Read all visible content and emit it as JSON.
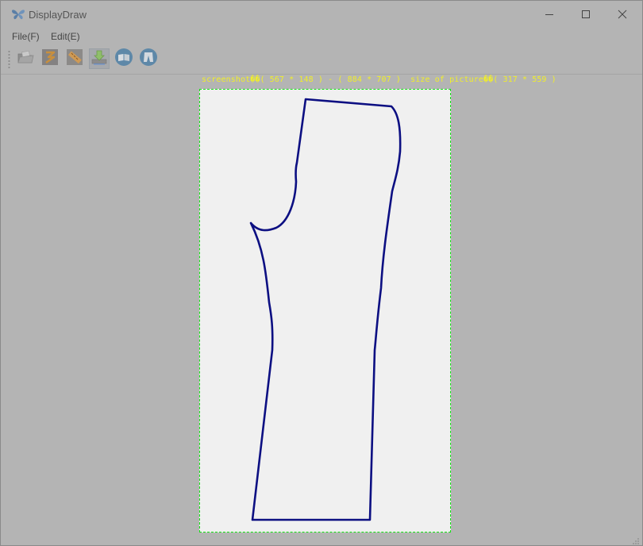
{
  "window": {
    "title": "DisplayDraw",
    "controls": {
      "minimize": "minimize-icon",
      "maximize": "maximize-icon",
      "close": "close-icon"
    }
  },
  "menu": {
    "items": [
      {
        "label": "File(F)"
      },
      {
        "label": "Edit(E)"
      }
    ]
  },
  "toolbar": {
    "buttons": [
      {
        "icon": "open-folder-icon"
      },
      {
        "icon": "pattern-icon"
      },
      {
        "icon": "ruler-icon"
      },
      {
        "icon": "download-icon",
        "active": true
      },
      {
        "icon": "book-icon"
      },
      {
        "icon": "trousers-icon"
      }
    ]
  },
  "canvas": {
    "info_text": "screenshot\u0000\u0000( 567 * 148 ) - ( 884 * 707 )  size of picture\u0000\u0000( 317 * 559 )",
    "info_display": "screenshot��( 567 * 148 ) - ( 884 * 707 )  size of picture��( 317 * 559 )",
    "frame_border_color": "#14e014",
    "outline_color": "#0c0f82"
  }
}
